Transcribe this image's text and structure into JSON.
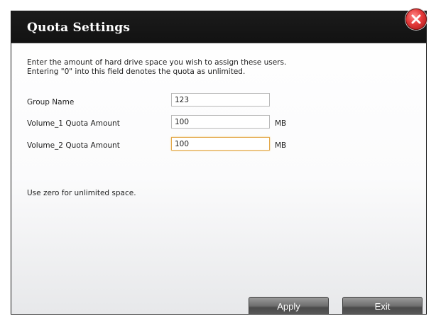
{
  "dialog": {
    "title": "Quota Settings",
    "description_line1": "Enter the amount of hard drive space you wish to assign these users.",
    "description_line2": "Entering \"0\" into this field denotes the quota as unlimited.",
    "fields": [
      {
        "label": "Group Name",
        "value": "123",
        "unit": ""
      },
      {
        "label": "Volume_1 Quota Amount",
        "value": "100",
        "unit": "MB"
      },
      {
        "label": "Volume_2 Quota Amount",
        "value": "100",
        "unit": "MB"
      }
    ],
    "hint": "Use zero for unlimited space.",
    "buttons": {
      "apply": "Apply",
      "exit": "Exit"
    },
    "close_icon": "close-icon",
    "colors": {
      "titlebar": "#121212",
      "close": "#e53b3b",
      "focus_border": "#e3a84a"
    }
  }
}
